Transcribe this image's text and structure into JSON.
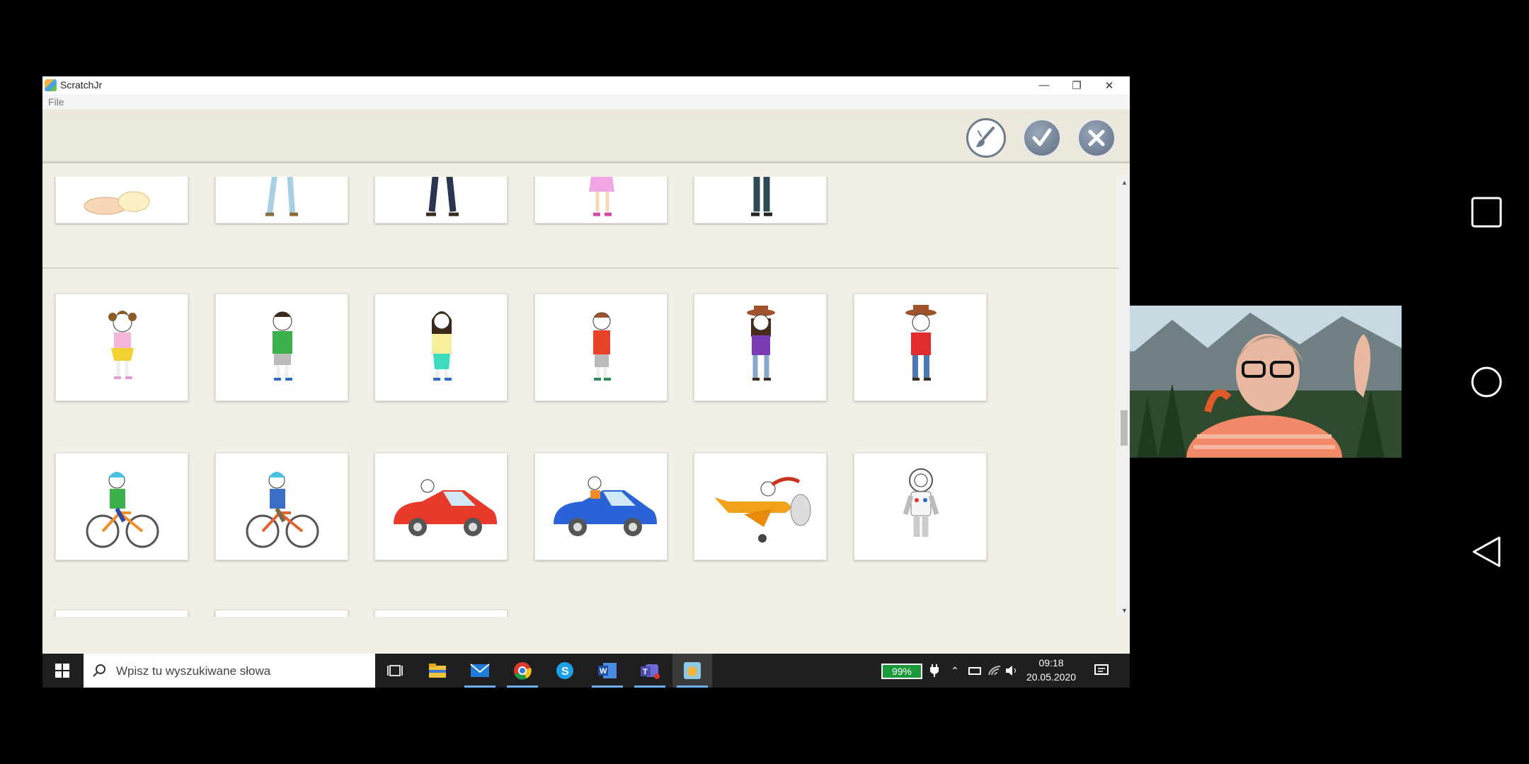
{
  "window": {
    "title": "ScratchJr",
    "menu_file": "File"
  },
  "toolbar": {
    "paint_icon": "paintbrush-icon",
    "ok_icon": "checkmark-icon",
    "cancel_icon": "close-icon"
  },
  "library": {
    "row_partial_top": [
      "baby",
      "boy-legs",
      "man-legs",
      "girl-legs",
      "man2-legs"
    ],
    "row_people": [
      "girl",
      "boy",
      "woman",
      "boy-red",
      "cowgirl",
      "cowboy"
    ],
    "row_vehicles": [
      "girl-bicycle",
      "boy-bicycle",
      "red-convertible",
      "blue-convertible",
      "airplane",
      "astronaut"
    ]
  },
  "taskbar": {
    "search_placeholder": "Wpisz tu wyszukiwane słowa",
    "battery": "99%",
    "time": "09:18",
    "date": "20.05.2020"
  },
  "colors": {
    "accent_battery": "#1a9a3a",
    "button": "#6d7b8e"
  }
}
